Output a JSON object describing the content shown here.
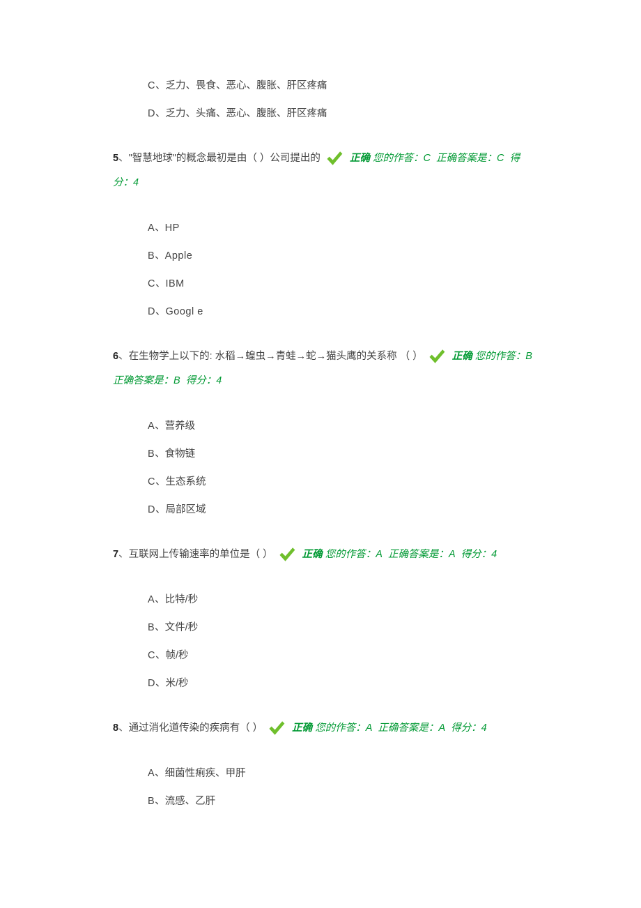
{
  "orphan_options": [
    {
      "letter": "C",
      "text": "乏力、畏食、恶心、腹胀、肝区疼痛"
    },
    {
      "letter": "D",
      "text": "乏力、头痛、恶心、腹胀、肝区疼痛"
    }
  ],
  "questions": [
    {
      "num": "5",
      "stem": "\"智慧地球\"的概念最初是由（ ）公司提出的",
      "status": "正确",
      "your_answer": "C",
      "correct_answer": "C",
      "points": "4",
      "options": [
        {
          "letter": "A",
          "text": "HP"
        },
        {
          "letter": "B",
          "text": "Apple"
        },
        {
          "letter": "C",
          "text": "IBM"
        },
        {
          "letter": "D",
          "text": "Googl e"
        }
      ]
    },
    {
      "num": "6",
      "stem": "在生物学上以下的: 水稻→蝗虫→青蛙→蛇→猫头鹰的关系称 （ ）",
      "status": "正确",
      "your_answer": "B",
      "correct_answer": "B",
      "points": "4",
      "options": [
        {
          "letter": "A",
          "text": "营养级"
        },
        {
          "letter": "B",
          "text": "食物链"
        },
        {
          "letter": "C",
          "text": "生态系统"
        },
        {
          "letter": "D",
          "text": "局部区域"
        }
      ]
    },
    {
      "num": "7",
      "stem": "互联网上传输速率的单位是（ ）",
      "status": "正确",
      "your_answer": "A",
      "correct_answer": "A",
      "points": "4",
      "options": [
        {
          "letter": "A",
          "text": "比特/秒"
        },
        {
          "letter": "B",
          "text": "文件/秒"
        },
        {
          "letter": "C",
          "text": "帧/秒"
        },
        {
          "letter": "D",
          "text": "米/秒"
        }
      ]
    },
    {
      "num": "8",
      "stem": "通过消化道传染的疾病有（ ）",
      "status": "正确",
      "your_answer": "A",
      "correct_answer": "A",
      "points": "4",
      "options": [
        {
          "letter": "A",
          "text": "细菌性痢疾、甲肝"
        },
        {
          "letter": "B",
          "text": "流感、乙肝"
        }
      ]
    }
  ],
  "labels": {
    "your": "您的作答：",
    "correct_ans": "正确答案是：",
    "points": "得分："
  }
}
